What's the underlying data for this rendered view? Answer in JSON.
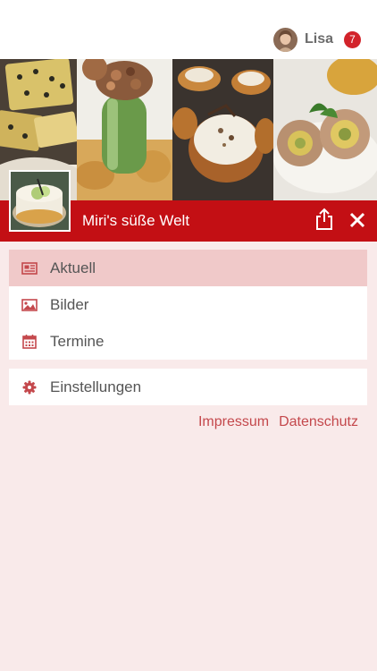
{
  "header": {
    "username": "Lisa",
    "notification_count": "7"
  },
  "blog": {
    "title": "Miri's süße Welt"
  },
  "menu": {
    "items": [
      {
        "label": "Aktuell",
        "icon": "newspaper-icon",
        "active": true
      },
      {
        "label": "Bilder",
        "icon": "image-icon",
        "active": false
      },
      {
        "label": "Termine",
        "icon": "calendar-icon",
        "active": false
      }
    ],
    "settings": {
      "label": "Einstellungen",
      "icon": "gear-icon"
    }
  },
  "footer": {
    "links": [
      "Impressum",
      "Datenschutz"
    ]
  },
  "colors": {
    "accent": "#c30f14",
    "badge": "#d2232a",
    "background": "#f9eaea",
    "active_item": "#f0c9c9",
    "icon": "#c4484c",
    "link": "#c4484c"
  }
}
